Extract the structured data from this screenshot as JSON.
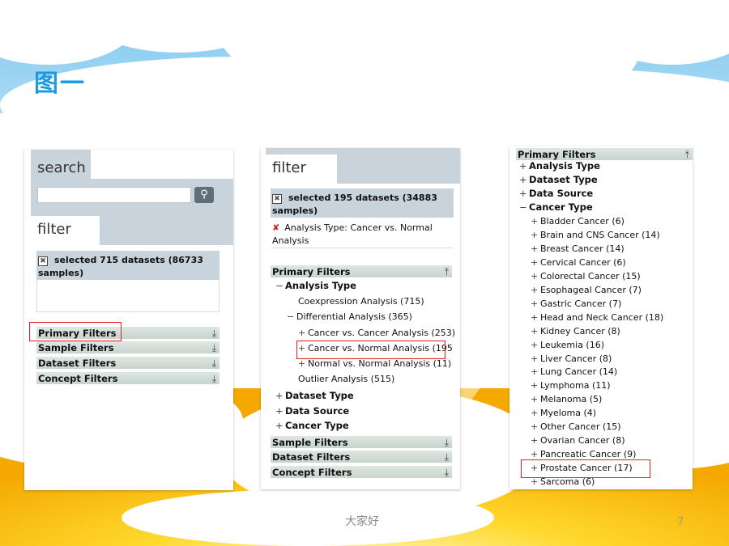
{
  "slide": {
    "title": "图一",
    "footer": "大家好",
    "page_number": "7"
  },
  "panel1": {
    "search_tab": "search",
    "search_placeholder": "",
    "search_button_icon": "magnifier-icon",
    "filter_tab": "filter",
    "selected_text": "selected 715 datasets (86733 samples)",
    "filters": [
      "Primary Filters",
      "Sample Filters",
      "Dataset Filters",
      "Concept Filters"
    ]
  },
  "panel2": {
    "filter_tab": "filter",
    "selected_text": "selected 195 datasets (34883 samples)",
    "active_filter": "Analysis Type: Cancer vs. Normal Analysis",
    "primary_filters": "Primary Filters",
    "analysis_type": "Analysis Type",
    "coexpression": "Coexpression Analysis (715)",
    "differential": "Differential Analysis (365)",
    "cvc": "Cancer vs. Cancer Analysis (253)",
    "cvn": "Cancer vs. Normal Analysis (195",
    "nvn": "Normal vs. Normal Analysis (11)",
    "outlier": "Outlier Analysis (515)",
    "dataset_type": "Dataset Type",
    "data_source": "Data Source",
    "cancer_type": "Cancer Type",
    "lower_filters": [
      "Sample Filters",
      "Dataset Filters",
      "Concept Filters"
    ]
  },
  "panel3": {
    "primary_filters": "Primary Filters",
    "top_items": [
      "Analysis Type",
      "Dataset Type",
      "Data Source",
      "Cancer Type"
    ],
    "cancers": [
      "Bladder Cancer (6)",
      "Brain and CNS Cancer (14)",
      "Breast Cancer (14)",
      "Cervical Cancer (6)",
      "Colorectal Cancer (15)",
      "Esophageal Cancer (7)",
      "Gastric Cancer (7)",
      "Head and Neck Cancer (18)",
      "Kidney Cancer (8)",
      "Leukemia (16)",
      "Liver Cancer (8)",
      "Lung Cancer (14)",
      "Lymphoma (11)",
      "Melanoma (5)",
      "Myeloma (4)",
      "Other Cancer (15)",
      "Ovarian Cancer (8)",
      "Pancreatic Cancer (9)",
      "Prostate Cancer (17)",
      "Sarcoma (6)"
    ]
  }
}
